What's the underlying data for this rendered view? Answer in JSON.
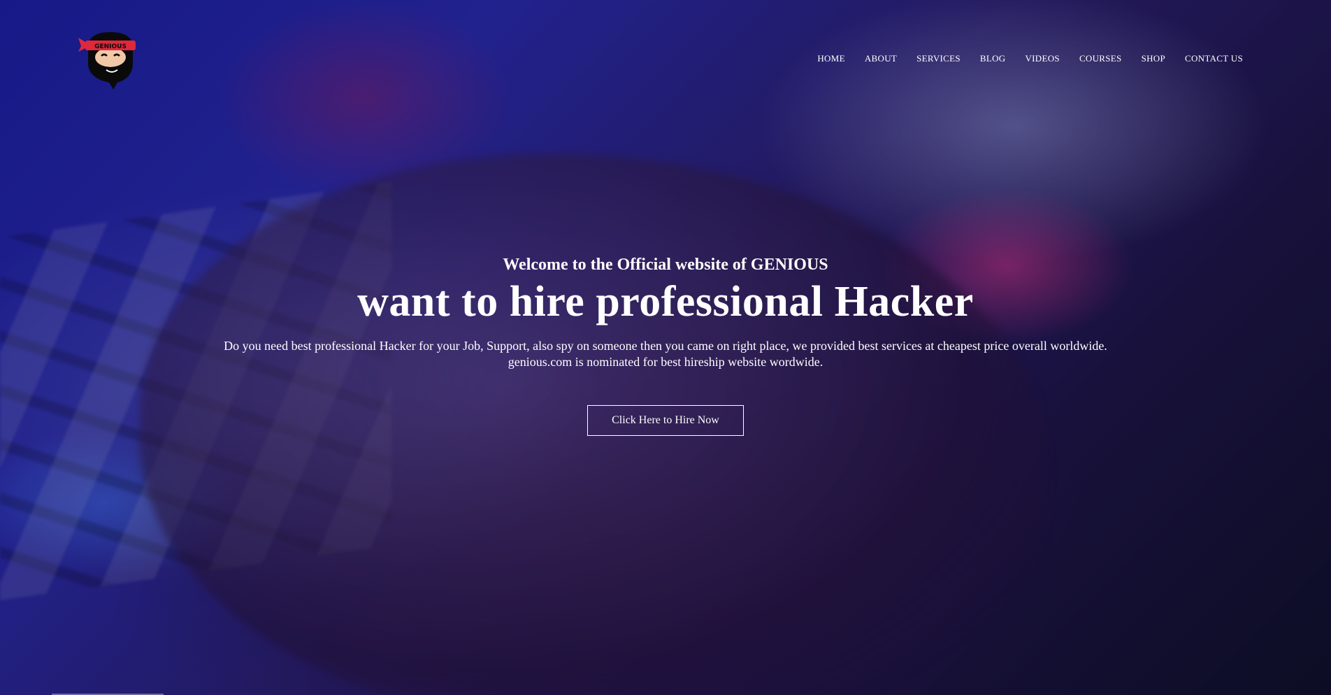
{
  "brand": {
    "logo_text": "GENIOUS",
    "logo_icon": "ninja-mascot-icon"
  },
  "nav": {
    "items": [
      {
        "label": "HOME"
      },
      {
        "label": "ABOUT"
      },
      {
        "label": "SERVICES"
      },
      {
        "label": "BLOG"
      },
      {
        "label": "VIDEOS"
      },
      {
        "label": "COURSES"
      },
      {
        "label": "SHOP"
      },
      {
        "label": "CONTACT US"
      }
    ]
  },
  "hero": {
    "kicker": "Welcome to the Official website of GENIOUS",
    "headline": "want to hire professional Hacker",
    "description_line1": "Do you need best professional Hacker for your Job, Support, also spy on someone then you came on right place, we provided best services at cheapest price overall worldwide.",
    "description_line2": "genious.com is nominated for best hireship website wordwide.",
    "cta_label": "Click Here to Hire Now"
  },
  "colors": {
    "text": "#ffffff",
    "logo_band": "#e0283c",
    "background_primary": "#1a1fa8",
    "background_dark": "#0d0f24"
  }
}
